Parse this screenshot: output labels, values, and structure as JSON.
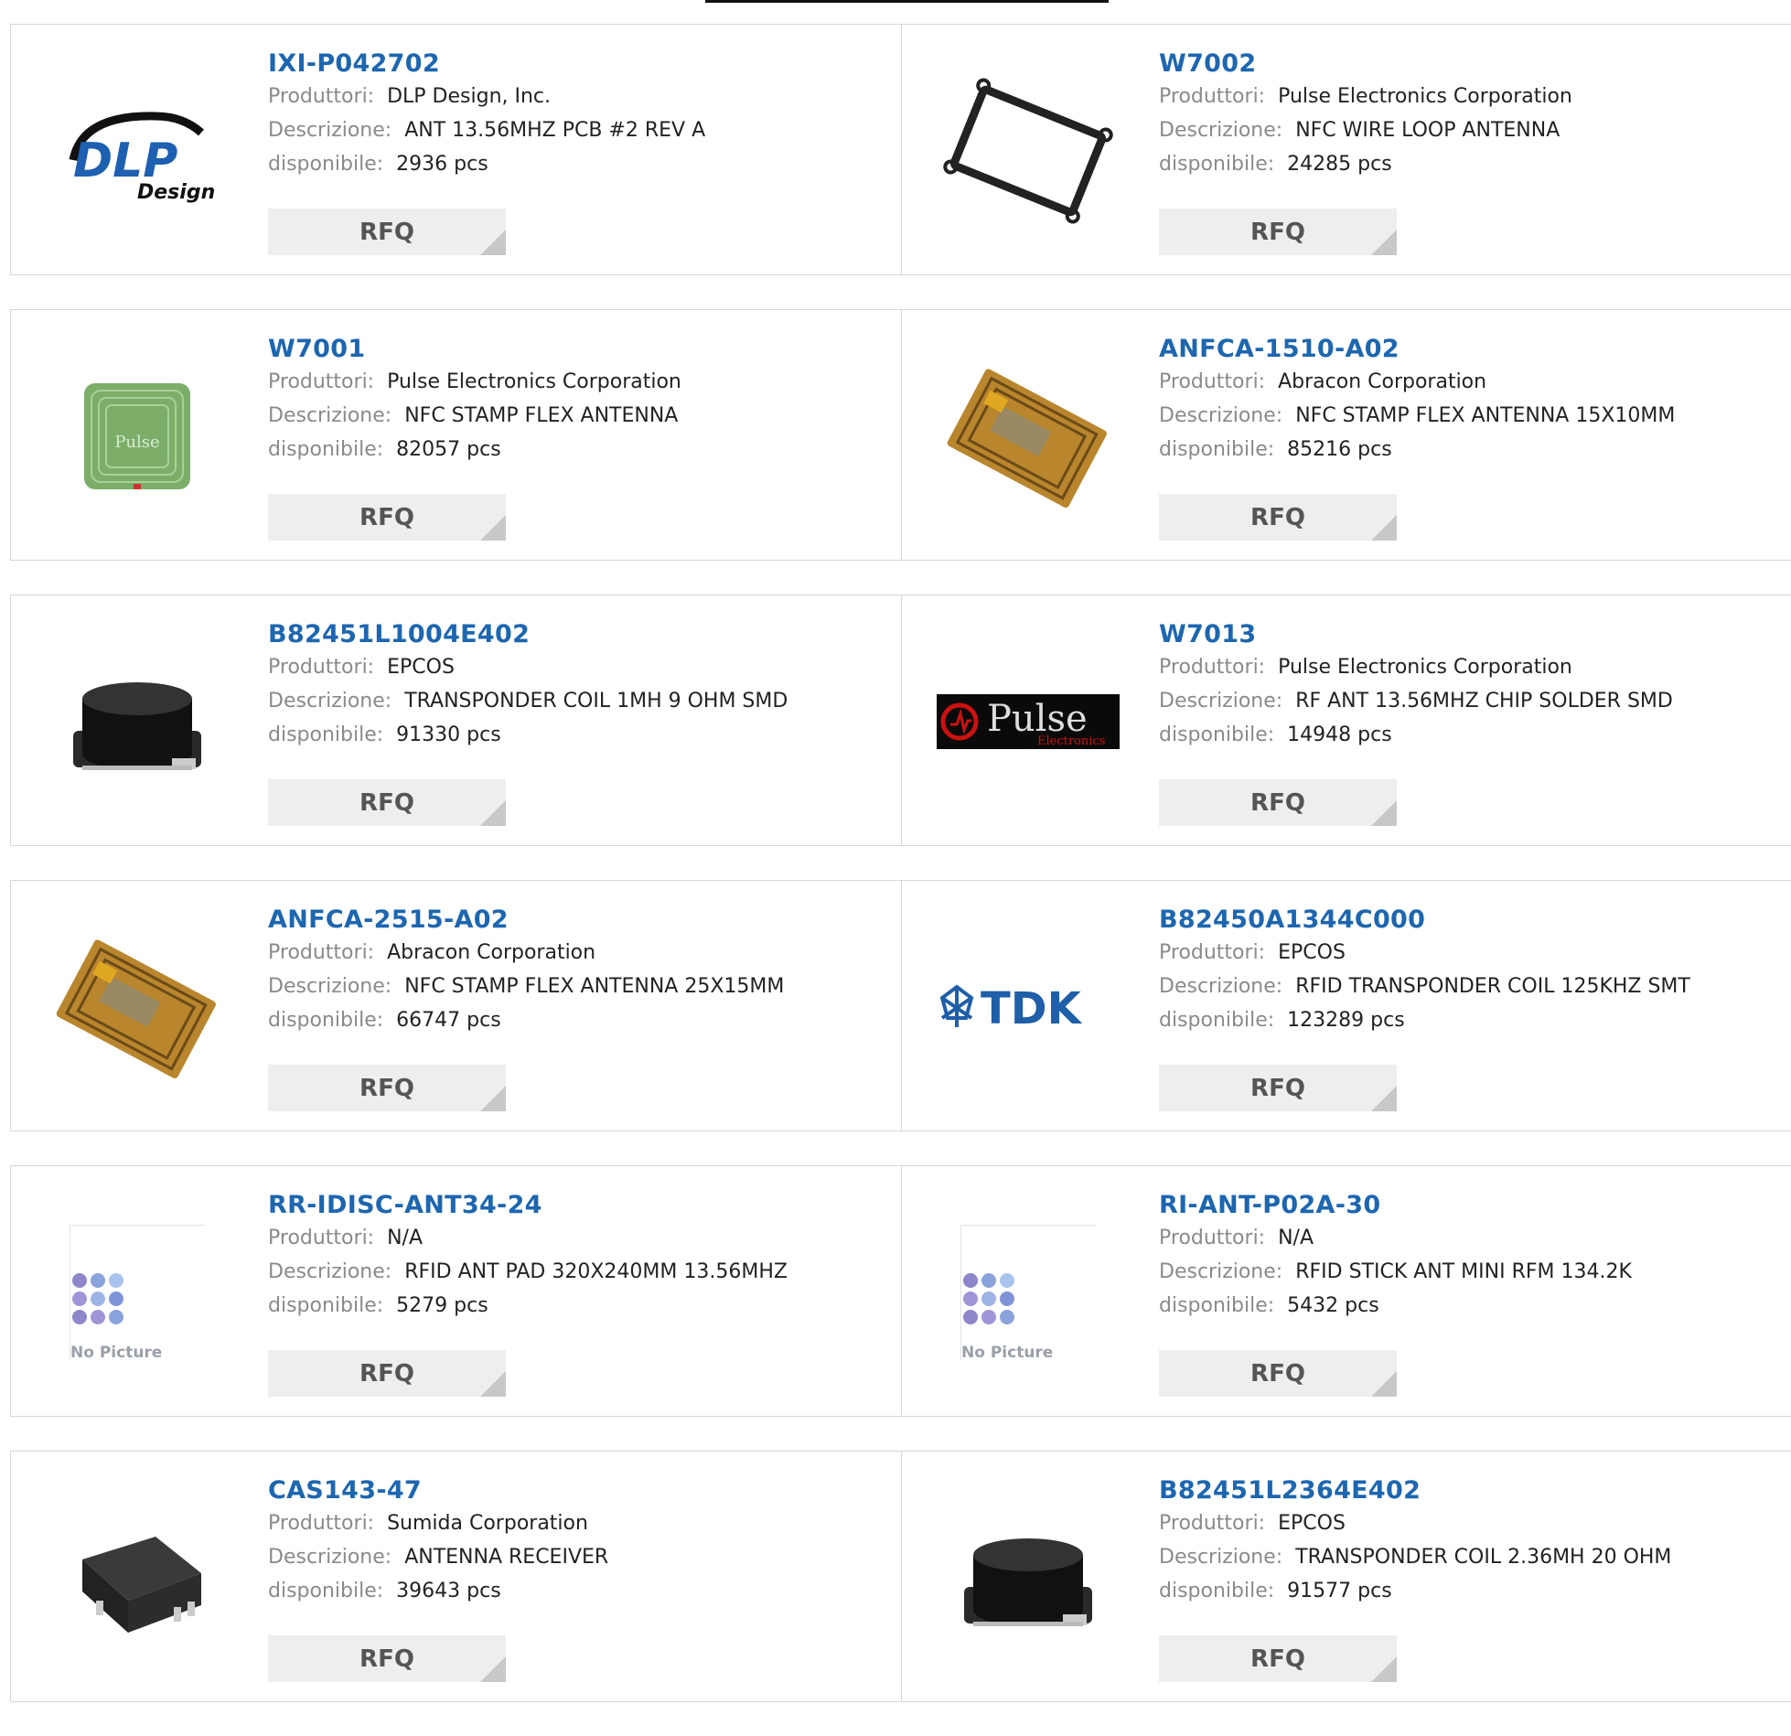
{
  "labels": {
    "manufacturer": "Produttori:",
    "description": "Descrizione:",
    "available": "disponibile:",
    "rfq": "RFQ",
    "no_picture": "No Picture"
  },
  "products": [
    {
      "pn": "IXI-P042702",
      "manufacturer": "DLP Design, Inc.",
      "description": "ANT 13.56MHZ PCB #2 REV A",
      "available": "2936 pcs",
      "image": "dlp-design-logo"
    },
    {
      "pn": "W7002",
      "manufacturer": "Pulse Electronics Corporation",
      "description": "NFC WIRE LOOP ANTENNA",
      "available": "24285 pcs",
      "image": "wire-loop-antenna"
    },
    {
      "pn": "W7001",
      "manufacturer": "Pulse Electronics Corporation",
      "description": "NFC STAMP FLEX ANTENNA",
      "available": "82057 pcs",
      "image": "green-pulse-antenna"
    },
    {
      "pn": "ANFCA-1510-A02",
      "manufacturer": "Abracon Corporation",
      "description": "NFC STAMP FLEX ANTENNA 15X10MM",
      "available": "85216 pcs",
      "image": "flex-antenna"
    },
    {
      "pn": "B82451L1004E402",
      "manufacturer": "EPCOS",
      "description": "TRANSPONDER COIL 1MH 9 OHM SMD",
      "available": "91330 pcs",
      "image": "smd-coil"
    },
    {
      "pn": "W7013",
      "manufacturer": "Pulse Electronics Corporation",
      "description": "RF ANT 13.56MHZ CHIP SOLDER SMD",
      "available": "14948 pcs",
      "image": "pulse-logo"
    },
    {
      "pn": "ANFCA-2515-A02",
      "manufacturer": "Abracon Corporation",
      "description": "NFC STAMP FLEX ANTENNA 25X15MM",
      "available": "66747 pcs",
      "image": "flex-antenna"
    },
    {
      "pn": "B82450A1344C000",
      "manufacturer": "EPCOS",
      "description": "RFID TRANSPONDER COIL 125KHZ SMT",
      "available": "123289 pcs",
      "image": "tdk-logo"
    },
    {
      "pn": "RR-IDISC-ANT34-24",
      "manufacturer": "N/A",
      "description": "RFID ANT PAD 320X240MM 13.56MHZ",
      "available": "5279 pcs",
      "image": "no-picture"
    },
    {
      "pn": "RI-ANT-P02A-30",
      "manufacturer": "N/A",
      "description": "RFID STICK ANT MINI RFM 134.2K",
      "available": "5432 pcs",
      "image": "no-picture"
    },
    {
      "pn": "CAS143-47",
      "manufacturer": "Sumida Corporation",
      "description": "ANTENNA RECEIVER",
      "available": "39643 pcs",
      "image": "receiver-coil"
    },
    {
      "pn": "B82451L2364E402",
      "manufacturer": "EPCOS",
      "description": "TRANSPONDER COIL 2.36MH 20 OHM",
      "available": "91577 pcs",
      "image": "smd-coil"
    }
  ],
  "logos": {
    "dlp": "DLP",
    "dlp_sub": "Design",
    "pulse": "Pulse",
    "pulse_sub": "Electronics",
    "tdk": "TDK",
    "green_pulse": "Pulse"
  },
  "colors": {
    "link": "#1d66b0",
    "label": "#8a8a8a",
    "button_bg": "#eeeeee",
    "border": "#d6d6d6"
  }
}
